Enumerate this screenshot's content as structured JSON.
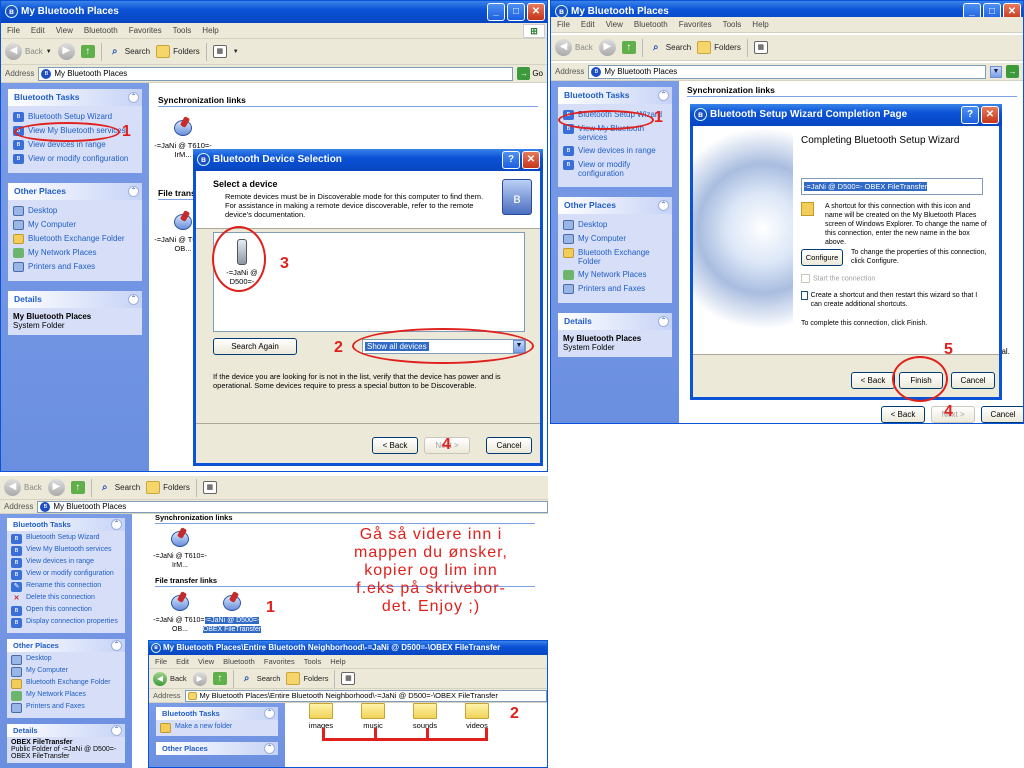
{
  "common": {
    "menu": [
      "File",
      "Edit",
      "View",
      "Bluetooth",
      "Favorites",
      "Tools",
      "Help"
    ],
    "back": "Back",
    "search": "Search",
    "folders": "Folders",
    "address_label": "Address",
    "go": "Go",
    "sync_links": "Synchronization links",
    "file_transfer_links": "File transfer links",
    "bt_tasks_title": "Bluetooth Tasks",
    "other_places_title": "Other Places",
    "details_title": "Details",
    "other_places": [
      "Desktop",
      "My Computer",
      "Bluetooth Exchange Folder",
      "My Network Places",
      "Printers and Faxes"
    ]
  },
  "win1": {
    "title": "My Bluetooth Places",
    "address": "My Bluetooth Places",
    "tasks": [
      "Bluetooth Setup Wizard",
      "View My Bluetooth services",
      "View devices in range",
      "View or modify configuration"
    ],
    "details_name": "My Bluetooth Places",
    "details_type": "System Folder",
    "sync_device": "-=JaNi @ T610=- IrM...",
    "ft_device": "-=JaNi @ T610=- OB..."
  },
  "dialog1": {
    "title": "Bluetooth Device Selection",
    "heading": "Select a device",
    "desc": "Remote devices must be in Discoverable mode for this computer to find them. For assistance in making a remote device discoverable, refer to the remote device's documentation.",
    "device": "-=JaNi @ D500=-",
    "search_again": "Search Again",
    "filter": "Show all devices",
    "footer": "If the device you are looking for is not in the list, verify that the device has power and is operational. Some devices require to press a special button to be Discoverable.",
    "back": "< Back",
    "next": "Next >",
    "cancel": "Cancel"
  },
  "win2": {
    "title": "My Bluetooth Places",
    "address": "My Bluetooth Places",
    "tasks": [
      "Bluetooth Setup Wizard",
      "View My Bluetooth services",
      "View devices in range",
      "View or modify configuration"
    ],
    "details_name": "My Bluetooth Places",
    "details_type": "System Folder",
    "bg_back": "< Back",
    "bg_next": "Next >",
    "bg_cancel": "Cancel",
    "bg_frag1": "nal."
  },
  "dialog2": {
    "title": "Bluetooth Setup Wizard Completion Page",
    "heading": "Completing Bluetooth Setup Wizard",
    "name_value": "-=JaNi @ D500=- OBEX FileTransfer",
    "shortcut_text": "A shortcut for this connection with this icon and name will be created on the My Bluetooth Places screen of Windows Explorer.  To change the name of this connection, enter the new name in the box above.",
    "configure": "Configure",
    "configure_text": "To change the properties of this connection, click Configure.",
    "start_connection": "Start the connection",
    "create_shortcut": "Create a shortcut and then restart this wizard so that I can create additional shortcuts.",
    "finish_text": "To complete this connection, click Finish.",
    "back": "< Back",
    "finish": "Finish",
    "cancel": "Cancel"
  },
  "win3": {
    "address": "My Bluetooth Places",
    "tasks": [
      "Bluetooth Setup Wizard",
      "View My Bluetooth services",
      "View devices in range",
      "View or modify configuration",
      "Rename this connection",
      "Delete this connection",
      "Open this connection",
      "Display connection properties"
    ],
    "details_name": "OBEX FileTransfer",
    "details_type": "Public Folder of -=JaNi @ D500=- OBEX FileTransfer",
    "sync_device": "-=JaNi @ T610=- IrM...",
    "ft_device1": "-=JaNi @ T610=- OB...",
    "ft_device2": "-=JaNi @ D500=- OBEX FileTransfer"
  },
  "win4": {
    "title": "My Bluetooth Places\\Entire Bluetooth Neighborhood\\-=JaNi @ D500=-\\OBEX FileTransfer",
    "address": "My Bluetooth Places\\Entire Bluetooth Neighborhood\\-=JaNi @ D500=-\\OBEX FileTransfer",
    "task": "Make a new folder",
    "folders": [
      "images",
      "music",
      "sounds",
      "videos"
    ]
  },
  "annotations": {
    "n1": "1",
    "n2": "2",
    "n3": "3",
    "n4": "4",
    "n5": "5",
    "note": "Gå så videre inn i\nmappen du ønsker,\nkopier og lim inn\nf.eks på skrivebor-\ndet. Enjoy ;)"
  }
}
